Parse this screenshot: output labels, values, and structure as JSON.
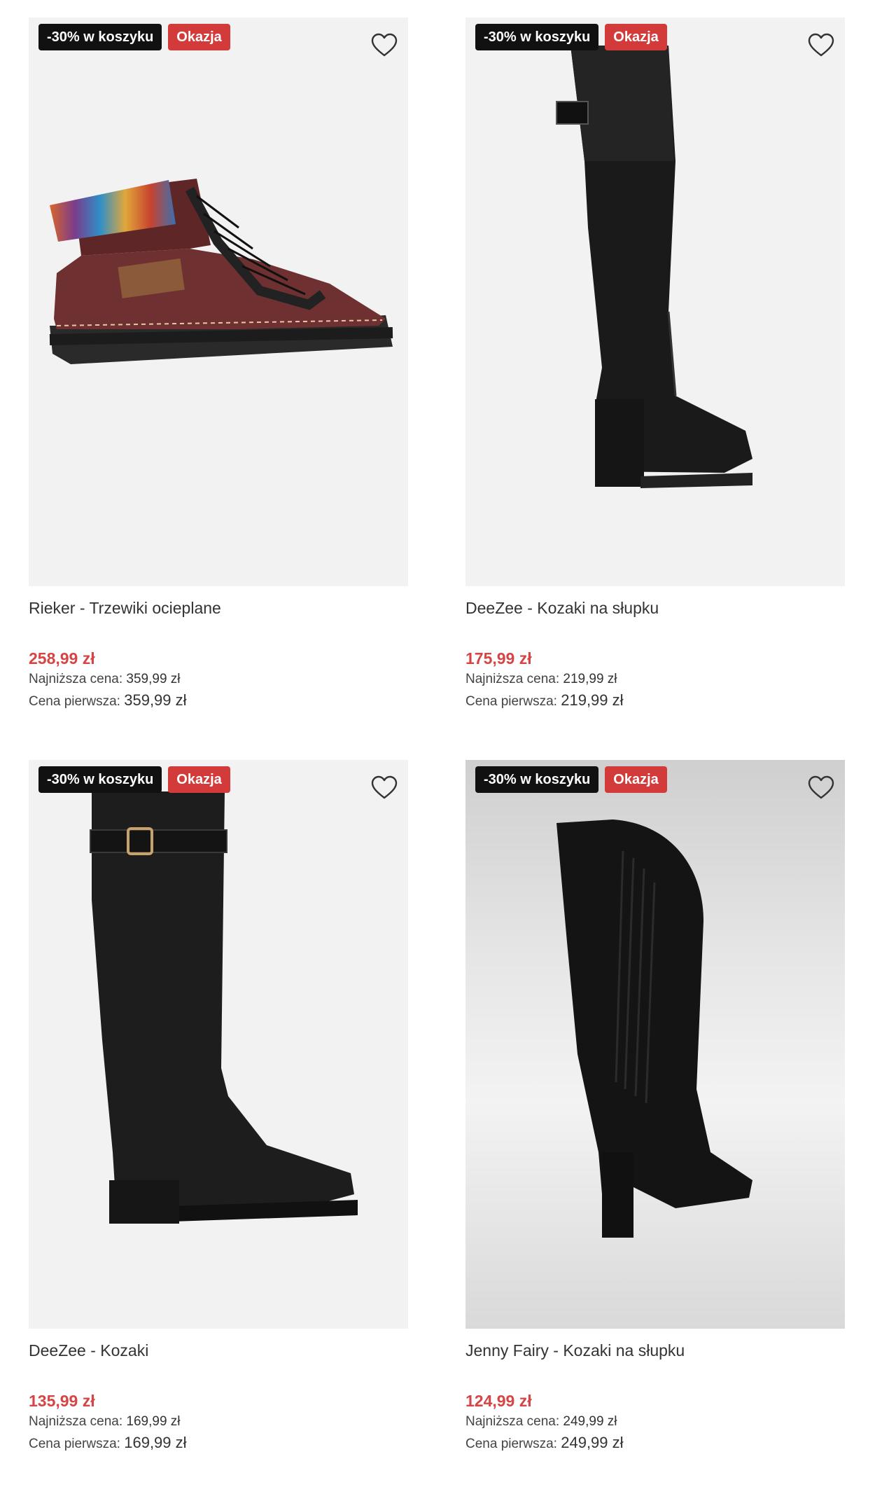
{
  "products": [
    {
      "badge_promo": "-30% w koszyku",
      "badge_deal": "Okazja",
      "name": "Rieker - Trzewiki ocieplane",
      "price": "258,99 zł",
      "lowest_label": "Najniższa cena:",
      "lowest_value": "359,99 zł",
      "first_label": "Cena pierwsza:",
      "first_value": "359,99 zł"
    },
    {
      "badge_promo": "-30% w koszyku",
      "badge_deal": "Okazja",
      "name": "DeeZee - Kozaki na słupku",
      "price": "175,99 zł",
      "lowest_label": "Najniższa cena:",
      "lowest_value": "219,99 zł",
      "first_label": "Cena pierwsza:",
      "first_value": "219,99 zł"
    },
    {
      "badge_promo": "-30% w koszyku",
      "badge_deal": "Okazja",
      "name": "DeeZee - Kozaki",
      "price": "135,99 zł",
      "lowest_label": "Najniższa cena:",
      "lowest_value": "169,99 zł",
      "first_label": "Cena pierwsza:",
      "first_value": "169,99 zł"
    },
    {
      "badge_promo": "-30% w koszyku",
      "badge_deal": "Okazja",
      "name": "Jenny Fairy - Kozaki na słupku",
      "price": "124,99 zł",
      "lowest_label": "Najniższa cena:",
      "lowest_value": "249,99 zł",
      "first_label": "Cena pierwsza:",
      "first_value": "249,99 zł"
    }
  ],
  "colors": {
    "price_red": "#d64545",
    "deal_badge": "#d33b3b",
    "promo_badge": "#111111",
    "image_bg": "#f2f2f2"
  },
  "icons": {
    "favorite": "heart-outline-icon"
  }
}
